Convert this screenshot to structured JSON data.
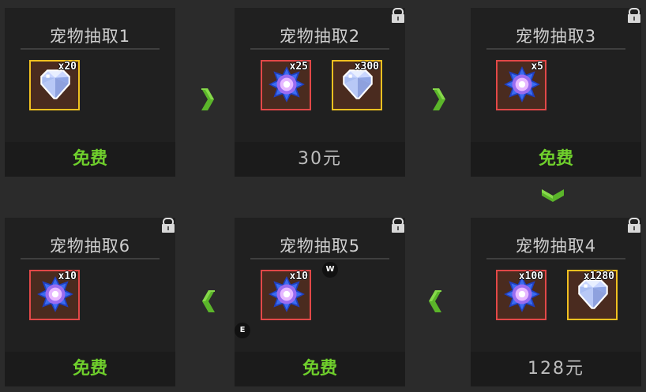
{
  "cards": [
    {
      "title": "宠物抽取1",
      "footer": "免费",
      "items": [
        {
          "icon": "diamond-icon",
          "qty": "x20"
        }
      ]
    },
    {
      "title": "宠物抽取2",
      "footer": "30元",
      "items": [
        {
          "icon": "star-gem-icon",
          "qty": "x25"
        },
        {
          "icon": "diamond-icon",
          "qty": "x300"
        }
      ]
    },
    {
      "title": "宠物抽取3",
      "footer": "免费",
      "items": [
        {
          "icon": "star-gem-icon",
          "qty": "x5"
        }
      ]
    },
    {
      "title": "宠物抽取4",
      "footer": "128元",
      "items": [
        {
          "icon": "star-gem-icon",
          "qty": "x100"
        },
        {
          "icon": "diamond-icon",
          "qty": "x1280"
        }
      ]
    },
    {
      "title": "宠物抽取5",
      "footer": "免费",
      "items": [
        {
          "icon": "star-gem-icon",
          "qty": "x10"
        }
      ]
    },
    {
      "title": "宠物抽取6",
      "footer": "免费",
      "items": [
        {
          "icon": "star-gem-icon",
          "qty": "x10"
        }
      ]
    }
  ],
  "hotkeys": {
    "w": "W",
    "e": "E"
  },
  "colors": {
    "free": "#6fcf2c",
    "arrow": "#5bb52a",
    "red_frame": "#e24848",
    "gold_frame": "#f0c020"
  }
}
